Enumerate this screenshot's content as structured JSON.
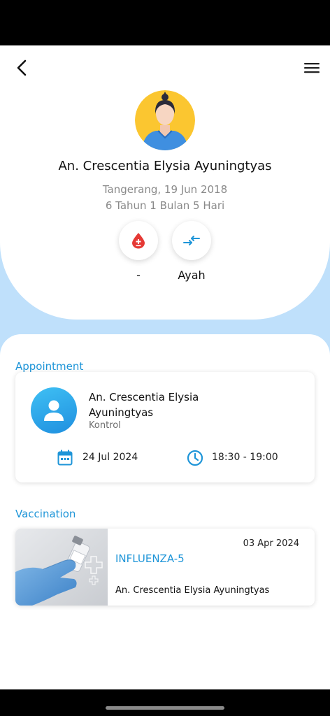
{
  "profile": {
    "name": "An. Crescentia Elysia Ayuningtyas",
    "birth": "Tangerang, 19 Jun 2018",
    "age": "6 Tahun 1 Bulan 5 Hari",
    "blood_type": "-",
    "relation": "Ayah"
  },
  "appointment": {
    "section_title": "Appointment",
    "patient_name": "An. Crescentia Elysia Ayuningtyas",
    "type": "Kontrol",
    "date": "24 Jul 2024",
    "time": "18:30 - 19:00"
  },
  "vaccination": {
    "section_title": "Vaccination",
    "date": "03 Apr 2024",
    "vaccine_name": "INFLUENZA-5",
    "patient_name": "An. Crescentia Elysia Ayuningtyas"
  },
  "icons": {
    "back": "back-arrow-icon",
    "menu": "hamburger-menu-icon",
    "blood": "blood-drop-icon",
    "relation": "swap-arrows-icon",
    "calendar": "calendar-icon",
    "clock": "clock-icon",
    "user": "user-icon"
  },
  "colors": {
    "accent": "#1e95d8",
    "background_blue": "#bfe0fb",
    "blood_red": "#e53935",
    "avatar_yellow": "#fbc630"
  }
}
